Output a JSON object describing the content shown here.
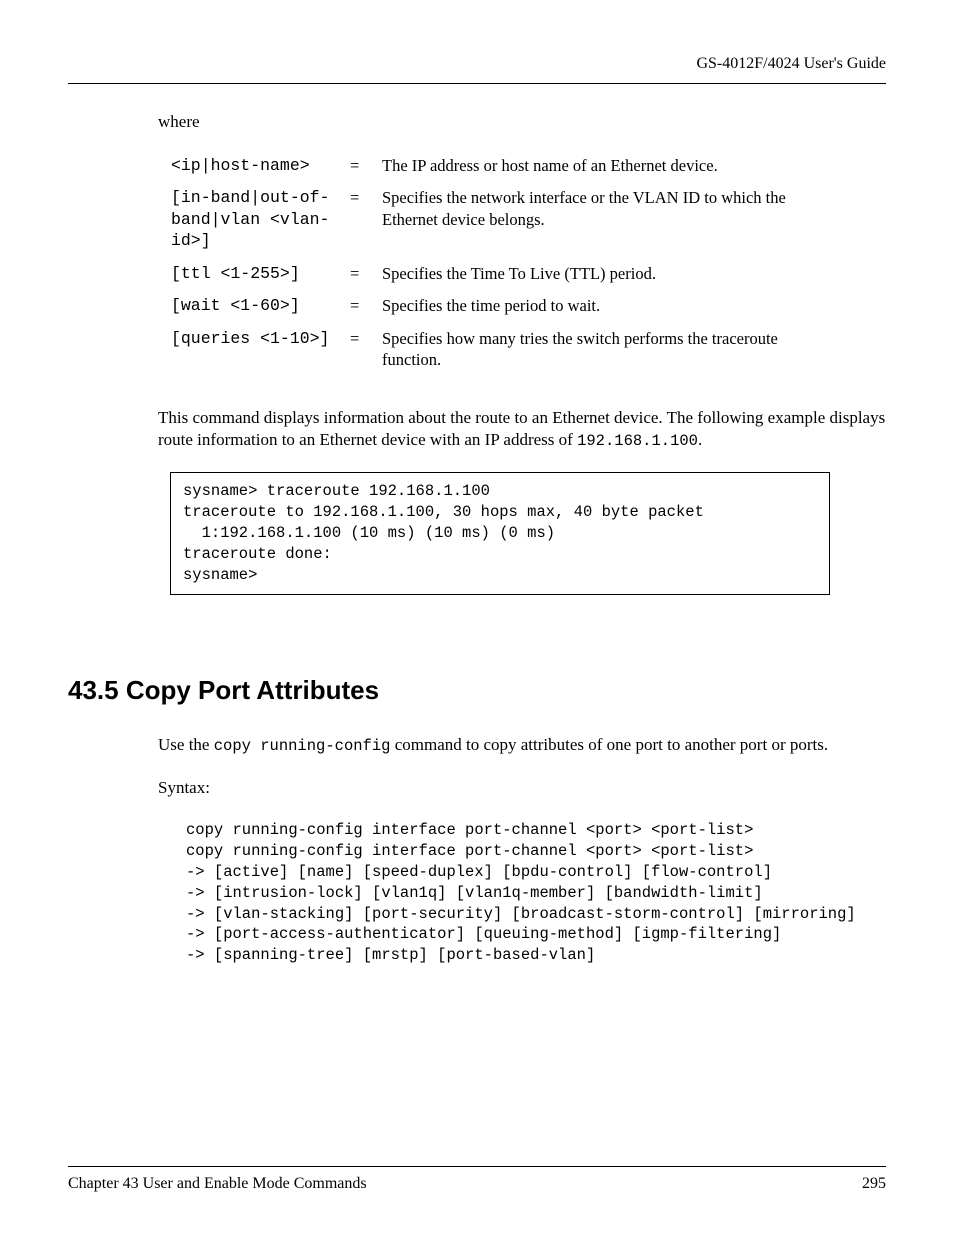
{
  "header": {
    "title": "GS-4012F/4024 User's Guide"
  },
  "where_label": "where",
  "params": [
    {
      "name": "<ip|host-name>",
      "eq": "=",
      "desc": "The IP address or host name of an Ethernet device."
    },
    {
      "name": "[in-band|out-of-band|vlan <vlan-id>]",
      "eq": "=",
      "desc": "Specifies the network interface or the VLAN ID to which the Ethernet device belongs."
    },
    {
      "name": "[ttl <1-255>]",
      "eq": "=",
      "desc": "Specifies the Time To Live (TTL) period."
    },
    {
      "name": "[wait <1-60>]",
      "eq": "=",
      "desc": "Specifies the time period to wait."
    },
    {
      "name": "[queries <1-10>]",
      "eq": "=",
      "desc": "Specifies how many tries the switch performs the traceroute function."
    }
  ],
  "para1_part1": "This command displays information about the route to an Ethernet device. The following example displays route information to an Ethernet device with an IP address of ",
  "para1_code": "192.168.1.100",
  "para1_part2": ".",
  "codebox": "sysname> traceroute 192.168.1.100\ntraceroute to 192.168.1.100, 30 hops max, 40 byte packet\n  1:192.168.1.100 (10 ms) (10 ms) (0 ms)\ntraceroute done:\nsysname>",
  "section": {
    "heading": "43.5  Copy Port Attributes",
    "para_pre": "Use the ",
    "para_code": "copy running-config",
    "para_post": " command to copy attributes of one port to another port or ports.",
    "syntax_label": "Syntax:",
    "syntax_block": "copy running-config interface port-channel <port> <port-list>\ncopy running-config interface port-channel <port> <port-list>\n-> [active] [name] [speed-duplex] [bpdu-control] [flow-control]\n-> [intrusion-lock] [vlan1q] [vlan1q-member] [bandwidth-limit]\n-> [vlan-stacking] [port-security] [broadcast-storm-control] [mirroring]\n-> [port-access-authenticator] [queuing-method] [igmp-filtering]\n-> [spanning-tree] [mrstp] [port-based-vlan]"
  },
  "footer": {
    "chapter": "Chapter 43  User and Enable Mode Commands",
    "page": "295"
  }
}
